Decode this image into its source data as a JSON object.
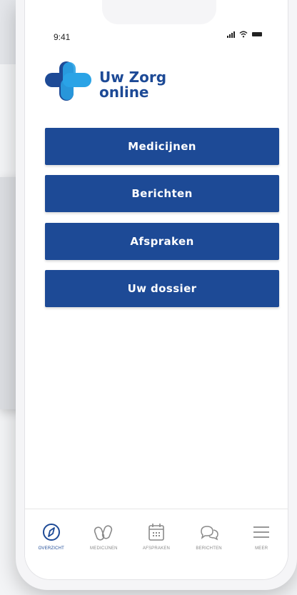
{
  "status_bar": {
    "time": "9:41"
  },
  "brand": {
    "line1": "Uw Zorg",
    "line2": "online",
    "color_primary": "#1d4a96",
    "color_secondary": "#2aa3e6"
  },
  "menu": {
    "items": [
      {
        "label": "Medicijnen"
      },
      {
        "label": "Berichten"
      },
      {
        "label": "Afspraken"
      },
      {
        "label": "Uw dossier"
      }
    ]
  },
  "tabbar": {
    "tabs": [
      {
        "label": "OVERZICHT",
        "icon": "compass-icon",
        "active": true
      },
      {
        "label": "MEDICIJNEN",
        "icon": "pills-icon",
        "active": false
      },
      {
        "label": "AFSPRAKEN",
        "icon": "calendar-icon",
        "active": false
      },
      {
        "label": "BERICHTEN",
        "icon": "chat-icon",
        "active": false
      },
      {
        "label": "MEER",
        "icon": "hamburger-menu-icon",
        "active": false
      }
    ]
  }
}
